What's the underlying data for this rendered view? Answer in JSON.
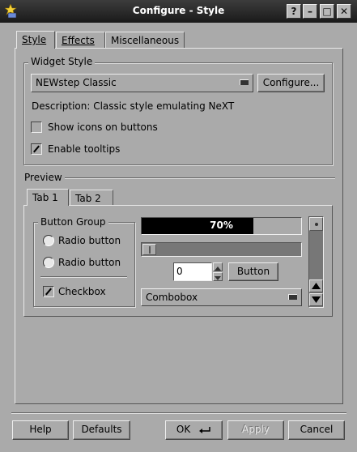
{
  "window": {
    "title": "Configure - Style",
    "buttons": {
      "help": "?",
      "minimize": "–",
      "maximize": "□",
      "close": "✕"
    }
  },
  "tabs": [
    {
      "label": "Style"
    },
    {
      "label": "Effects"
    },
    {
      "label": "Miscellaneous"
    }
  ],
  "widget_style": {
    "group_title": "Widget Style",
    "selected": "NEWstep Classic",
    "configure_label": "Configure...",
    "description": "Description: Classic style emulating NeXT",
    "show_icons_label": "Show icons on buttons",
    "show_icons_checked": false,
    "tooltips_label": "Enable tooltips",
    "tooltips_checked": true
  },
  "preview": {
    "title": "Preview",
    "tabs": [
      {
        "label": "Tab 1"
      },
      {
        "label": "Tab 2"
      }
    ],
    "button_group_title": "Button Group",
    "radio1": "Radio button",
    "radio2": "Radio button",
    "checkbox_label": "Checkbox",
    "checkbox_checked": true,
    "progress_text": "70%",
    "progress_value": 0.7,
    "spin_value": "0",
    "button_label": "Button",
    "combobox_value": "Combobox"
  },
  "footer": {
    "help": "Help",
    "defaults": "Defaults",
    "ok": "OK",
    "apply": "Apply",
    "cancel": "Cancel"
  }
}
